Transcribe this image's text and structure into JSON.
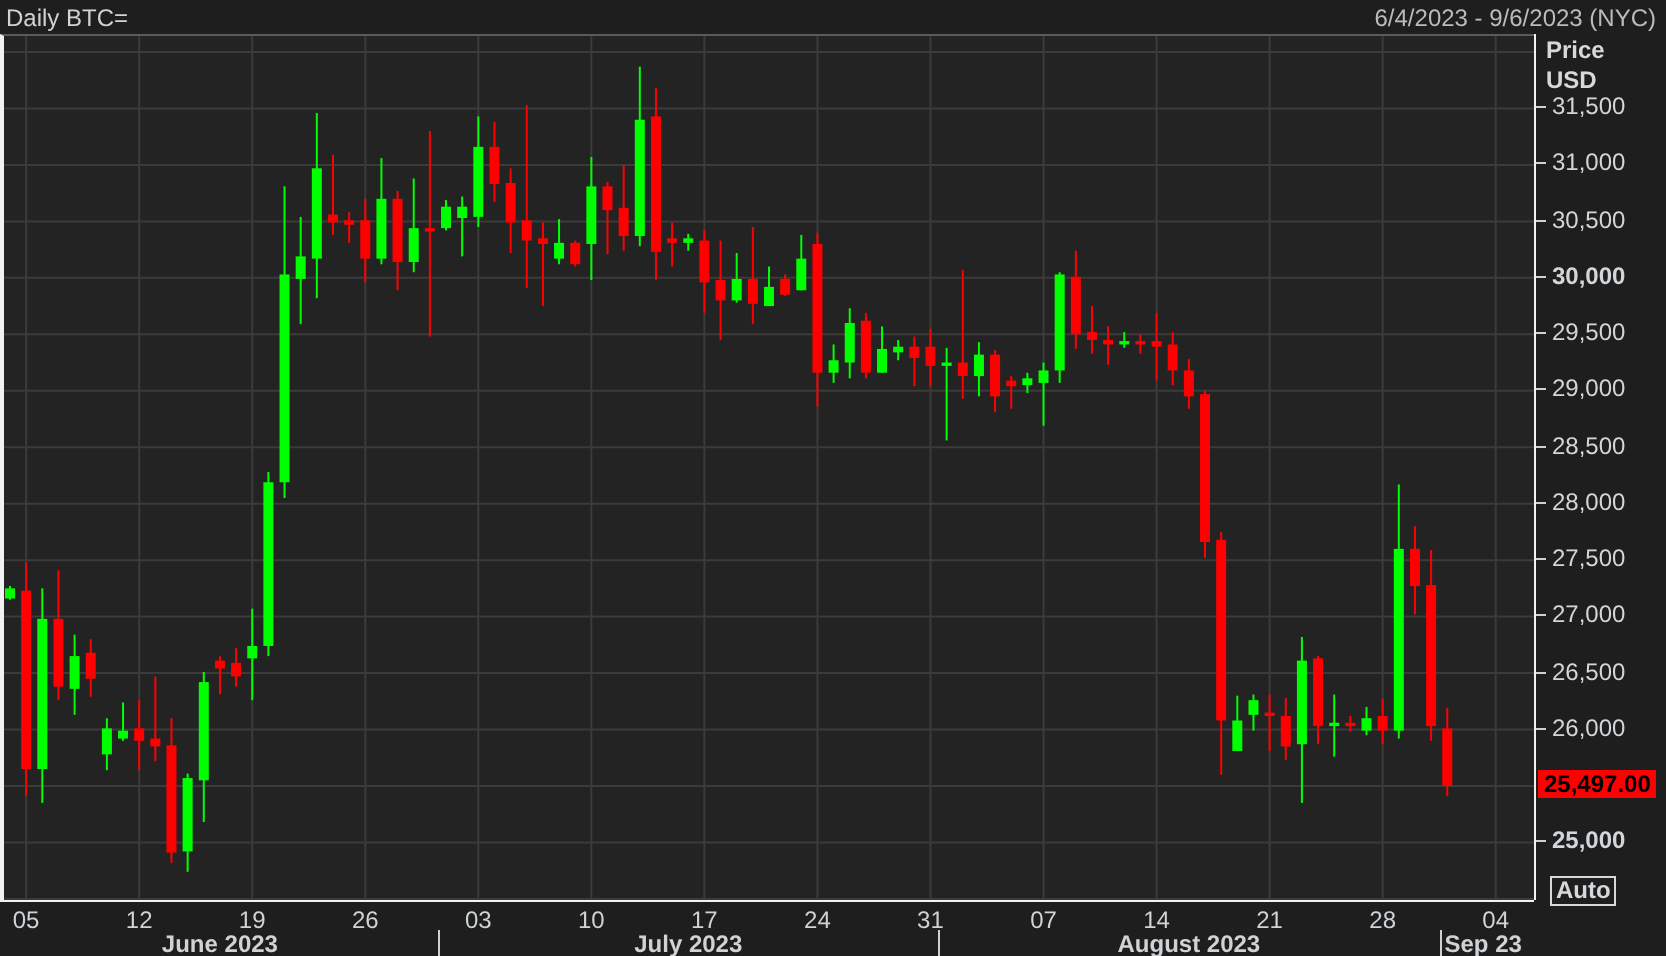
{
  "header": {
    "title": "Daily BTC=",
    "date_range": "6/4/2023 - 9/6/2023 (NYC)"
  },
  "y_axis": {
    "title_lines": [
      "Price",
      "USD"
    ],
    "ticks": [
      {
        "major": false
      },
      {
        "major": false
      },
      {
        "major": false
      },
      {
        "major": true
      },
      {
        "major": false
      },
      {
        "major": false
      },
      {
        "major": false
      },
      {
        "major": false
      },
      {
        "major": false
      },
      {
        "major": false
      },
      {
        "major": false
      },
      {
        "major": false
      },
      {
        "major": true
      }
    ]
  },
  "chart_data": {
    "type": "candlestick",
    "grid": true,
    "xlim": [
      "2023-06-04",
      "2023-09-06"
    ],
    "ylim": [
      24500,
      32000
    ],
    "xticks": [
      {
        "value": "2023-06-05",
        "label": "05"
      },
      {
        "value": "2023-06-12",
        "label": "12"
      },
      {
        "value": "2023-06-19",
        "label": "19"
      },
      {
        "value": "2023-06-26",
        "label": "26"
      },
      {
        "value": "2023-07-03",
        "label": "03"
      },
      {
        "value": "2023-07-10",
        "label": "10"
      },
      {
        "value": "2023-07-17",
        "label": "17"
      },
      {
        "value": "2023-07-24",
        "label": "24"
      },
      {
        "value": "2023-07-31",
        "label": "31"
      },
      {
        "value": "2023-08-07",
        "label": "07"
      },
      {
        "value": "2023-08-14",
        "label": "14"
      },
      {
        "value": "2023-08-21",
        "label": "21"
      },
      {
        "value": "2023-08-28",
        "label": "28"
      },
      {
        "value": "2023-09-04",
        "label": "04"
      }
    ],
    "x": [
      "2023-06-04",
      "2023-06-05",
      "2023-06-06",
      "2023-06-07",
      "2023-06-08",
      "2023-06-09",
      "2023-06-10",
      "2023-06-11",
      "2023-06-12",
      "2023-06-13",
      "2023-06-14",
      "2023-06-15",
      "2023-06-16",
      "2023-06-17",
      "2023-06-18",
      "2023-06-19",
      "2023-06-20",
      "2023-06-21",
      "2023-06-22",
      "2023-06-23",
      "2023-06-24",
      "2023-06-25",
      "2023-06-26",
      "2023-06-27",
      "2023-06-28",
      "2023-06-29",
      "2023-06-30",
      "2023-07-01",
      "2023-07-02",
      "2023-07-03",
      "2023-07-04",
      "2023-07-05",
      "2023-07-06",
      "2023-07-07",
      "2023-07-08",
      "2023-07-09",
      "2023-07-10",
      "2023-07-11",
      "2023-07-12",
      "2023-07-13",
      "2023-07-14",
      "2023-07-15",
      "2023-07-16",
      "2023-07-17",
      "2023-07-18",
      "2023-07-19",
      "2023-07-20",
      "2023-07-21",
      "2023-07-22",
      "2023-07-23",
      "2023-07-24",
      "2023-07-25",
      "2023-07-26",
      "2023-07-27",
      "2023-07-28",
      "2023-07-29",
      "2023-07-30",
      "2023-07-31",
      "2023-08-01",
      "2023-08-02",
      "2023-08-03",
      "2023-08-04",
      "2023-08-05",
      "2023-08-06",
      "2023-08-07",
      "2023-08-08",
      "2023-08-09",
      "2023-08-10",
      "2023-08-11",
      "2023-08-12",
      "2023-08-13",
      "2023-08-14",
      "2023-08-15",
      "2023-08-16",
      "2023-08-17",
      "2023-08-18",
      "2023-08-19",
      "2023-08-20",
      "2023-08-21",
      "2023-08-22",
      "2023-08-23",
      "2023-08-24",
      "2023-08-25",
      "2023-08-26",
      "2023-08-27",
      "2023-08-28",
      "2023-08-29",
      "2023-08-30",
      "2023-08-31",
      "2023-09-01"
    ],
    "ohlc": [
      [
        27160,
        27270,
        27150,
        27250
      ],
      [
        27230,
        27480,
        25410,
        25650
      ],
      [
        25650,
        27250,
        25350,
        26980
      ],
      [
        26980,
        27410,
        26260,
        26380
      ],
      [
        26360,
        26840,
        26130,
        26650
      ],
      [
        26680,
        26800,
        26290,
        26450
      ],
      [
        25780,
        26100,
        25640,
        26010
      ],
      [
        25920,
        26240,
        25900,
        25990
      ],
      [
        26010,
        26260,
        25640,
        25900
      ],
      [
        25920,
        26470,
        25720,
        25850
      ],
      [
        25860,
        26100,
        24820,
        24910
      ],
      [
        24920,
        25610,
        24740,
        25570
      ],
      [
        25550,
        26510,
        25180,
        26420
      ],
      [
        26610,
        26650,
        26310,
        26540
      ],
      [
        26590,
        26720,
        26380,
        26470
      ],
      [
        26630,
        27070,
        26260,
        26740
      ],
      [
        26740,
        28280,
        26650,
        28190
      ],
      [
        28190,
        30810,
        28050,
        30030
      ],
      [
        29990,
        30540,
        29590,
        30190
      ],
      [
        30170,
        31460,
        29820,
        30970
      ],
      [
        30560,
        31090,
        30380,
        30490
      ],
      [
        30510,
        30580,
        30310,
        30470
      ],
      [
        30510,
        30700,
        29960,
        30170
      ],
      [
        30170,
        31060,
        30120,
        30700
      ],
      [
        30700,
        30770,
        29890,
        30140
      ],
      [
        30140,
        30880,
        30050,
        30440
      ],
      [
        30440,
        31300,
        29480,
        30410
      ],
      [
        30440,
        30690,
        30420,
        30630
      ],
      [
        30530,
        30720,
        30190,
        30630
      ],
      [
        30540,
        31430,
        30450,
        31160
      ],
      [
        31160,
        31380,
        30670,
        30830
      ],
      [
        30840,
        30970,
        30220,
        30490
      ],
      [
        30510,
        31530,
        29910,
        30330
      ],
      [
        30350,
        30490,
        29750,
        30300
      ],
      [
        30170,
        30520,
        30120,
        30310
      ],
      [
        30310,
        30330,
        30100,
        30120
      ],
      [
        30300,
        31070,
        29980,
        30810
      ],
      [
        30810,
        30850,
        30210,
        30600
      ],
      [
        30620,
        31000,
        30240,
        30370
      ],
      [
        30370,
        31870,
        30280,
        31400
      ],
      [
        31430,
        31680,
        29980,
        30230
      ],
      [
        30350,
        30490,
        30100,
        30310
      ],
      [
        30310,
        30390,
        30240,
        30350
      ],
      [
        30330,
        30420,
        29690,
        29960
      ],
      [
        29980,
        30330,
        29450,
        29800
      ],
      [
        29800,
        30220,
        29780,
        29990
      ],
      [
        29990,
        30450,
        29590,
        29770
      ],
      [
        29750,
        30100,
        29750,
        29920
      ],
      [
        29990,
        30030,
        29840,
        29850
      ],
      [
        29890,
        30380,
        29890,
        30170
      ],
      [
        30300,
        30400,
        28860,
        29160
      ],
      [
        29160,
        29410,
        29070,
        29270
      ],
      [
        29250,
        29730,
        29110,
        29600
      ],
      [
        29620,
        29690,
        29110,
        29160
      ],
      [
        29160,
        29570,
        29160,
        29370
      ],
      [
        29340,
        29450,
        29270,
        29390
      ],
      [
        29390,
        29480,
        29040,
        29290
      ],
      [
        29390,
        29550,
        29040,
        29220
      ],
      [
        29220,
        29380,
        28560,
        29250
      ],
      [
        29250,
        30070,
        28930,
        29130
      ],
      [
        29130,
        29430,
        28950,
        29320
      ],
      [
        29320,
        29360,
        28810,
        28950
      ],
      [
        29090,
        29130,
        28840,
        29040
      ],
      [
        29050,
        29160,
        28980,
        29110
      ],
      [
        29070,
        29250,
        28690,
        29180
      ],
      [
        29180,
        30050,
        29070,
        30030
      ],
      [
        30010,
        30240,
        29370,
        29500
      ],
      [
        29520,
        29750,
        29330,
        29450
      ],
      [
        29450,
        29570,
        29230,
        29410
      ],
      [
        29410,
        29520,
        29380,
        29440
      ],
      [
        29440,
        29500,
        29330,
        29410
      ],
      [
        29440,
        29690,
        29090,
        29390
      ],
      [
        29410,
        29520,
        29050,
        29180
      ],
      [
        29180,
        29280,
        28840,
        28950
      ],
      [
        28970,
        29000,
        27520,
        27660
      ],
      [
        27680,
        27750,
        25600,
        26080
      ],
      [
        25810,
        26300,
        25810,
        26080
      ],
      [
        26130,
        26310,
        25990,
        26260
      ],
      [
        26150,
        26310,
        25810,
        26120
      ],
      [
        26120,
        26280,
        25730,
        25850
      ],
      [
        25870,
        26820,
        25350,
        26610
      ],
      [
        26630,
        26650,
        25870,
        26030
      ],
      [
        26030,
        26310,
        25760,
        26060
      ],
      [
        26060,
        26120,
        25980,
        26030
      ],
      [
        25990,
        26200,
        25950,
        26100
      ],
      [
        26120,
        26270,
        25870,
        25990
      ],
      [
        25990,
        28170,
        25920,
        27600
      ],
      [
        27600,
        27800,
        27020,
        27270
      ],
      [
        27280,
        27590,
        25900,
        26030
      ],
      [
        26010,
        26190,
        25410,
        25500
      ]
    ],
    "yticks": [
      {
        "value": 31500,
        "label": "31,500"
      },
      {
        "value": 31000,
        "label": "31,000"
      },
      {
        "value": 30500,
        "label": "30,500"
      },
      {
        "value": 30000,
        "label": "30,000"
      },
      {
        "value": 29500,
        "label": "29,500"
      },
      {
        "value": 29000,
        "label": "29,000"
      },
      {
        "value": 28500,
        "label": "28,500"
      },
      {
        "value": 28000,
        "label": "28,000"
      },
      {
        "value": 27500,
        "label": "27,500"
      },
      {
        "value": 27000,
        "label": "27,000"
      },
      {
        "value": 26500,
        "label": "26,500"
      },
      {
        "value": 26000,
        "label": "26,000"
      },
      {
        "value": 25000,
        "label": "25,000"
      }
    ]
  },
  "last_price": "25,497.00",
  "auto_button": "Auto",
  "x_axis": {
    "months": [
      {
        "label": "June 2023"
      },
      {
        "label": "July 2023"
      },
      {
        "label": "August 2023"
      },
      {
        "label": "Sep 23"
      }
    ]
  }
}
